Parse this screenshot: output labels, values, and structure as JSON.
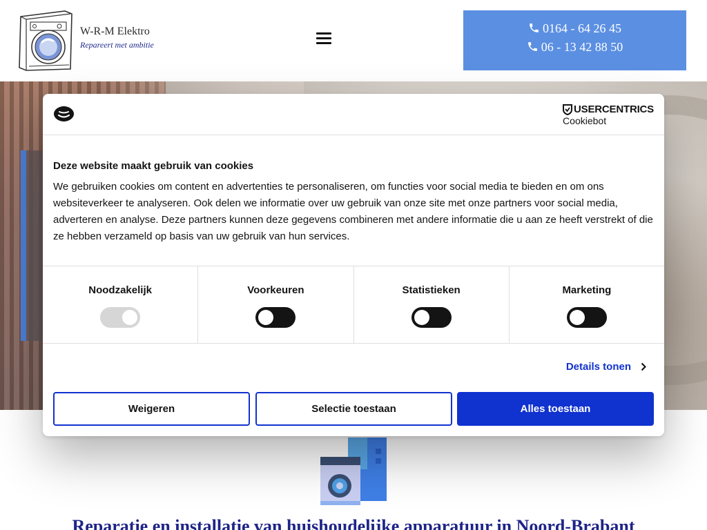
{
  "header": {
    "brand_name": "W-R-M Elektro",
    "tagline": "Repareert met ambitie",
    "logo_icon": "washing-machine-icon",
    "menu_icon": "hamburger-menu-icon",
    "phone_icon": "phone-icon",
    "phones": [
      "0164 - 64 26 45",
      "06 - 13 42 88 50"
    ],
    "phone_box_color": "#5b8fe2"
  },
  "main": {
    "heading": "Reparatie en installatie van huishoudelijke apparatuur in Noord-Brabant",
    "heading_color": "#1e2487",
    "feature_icon": "appliance-icon"
  },
  "cookie_dialog": {
    "provider_logo": "cookiebot-logo-icon",
    "provider_brand": "USERCENTRICS",
    "provider_product": "Cookiebot",
    "title": "Deze website maakt gebruik van cookies",
    "body": "We gebruiken cookies om content en advertenties te personaliseren, om functies voor social media te bieden en om ons websiteverkeer te analyseren. Ook delen we informatie over uw gebruik van onze site met onze partners voor social media, adverteren en analyse. Deze partners kunnen deze gegevens combineren met andere informatie die u aan ze heeft verstrekt of die ze hebben verzameld op basis van uw gebruik van hun services.",
    "categories": [
      {
        "label": "Noodzakelijk",
        "enabled": true,
        "locked": true
      },
      {
        "label": "Voorkeuren",
        "enabled": false,
        "locked": false
      },
      {
        "label": "Statistieken",
        "enabled": false,
        "locked": false
      },
      {
        "label": "Marketing",
        "enabled": false,
        "locked": false
      }
    ],
    "details_label": "Details tonen",
    "buttons": {
      "reject": "Weigeren",
      "allow_selection": "Selectie toestaan",
      "allow_all": "Alles toestaan"
    },
    "accent_color": "#1032cf"
  }
}
